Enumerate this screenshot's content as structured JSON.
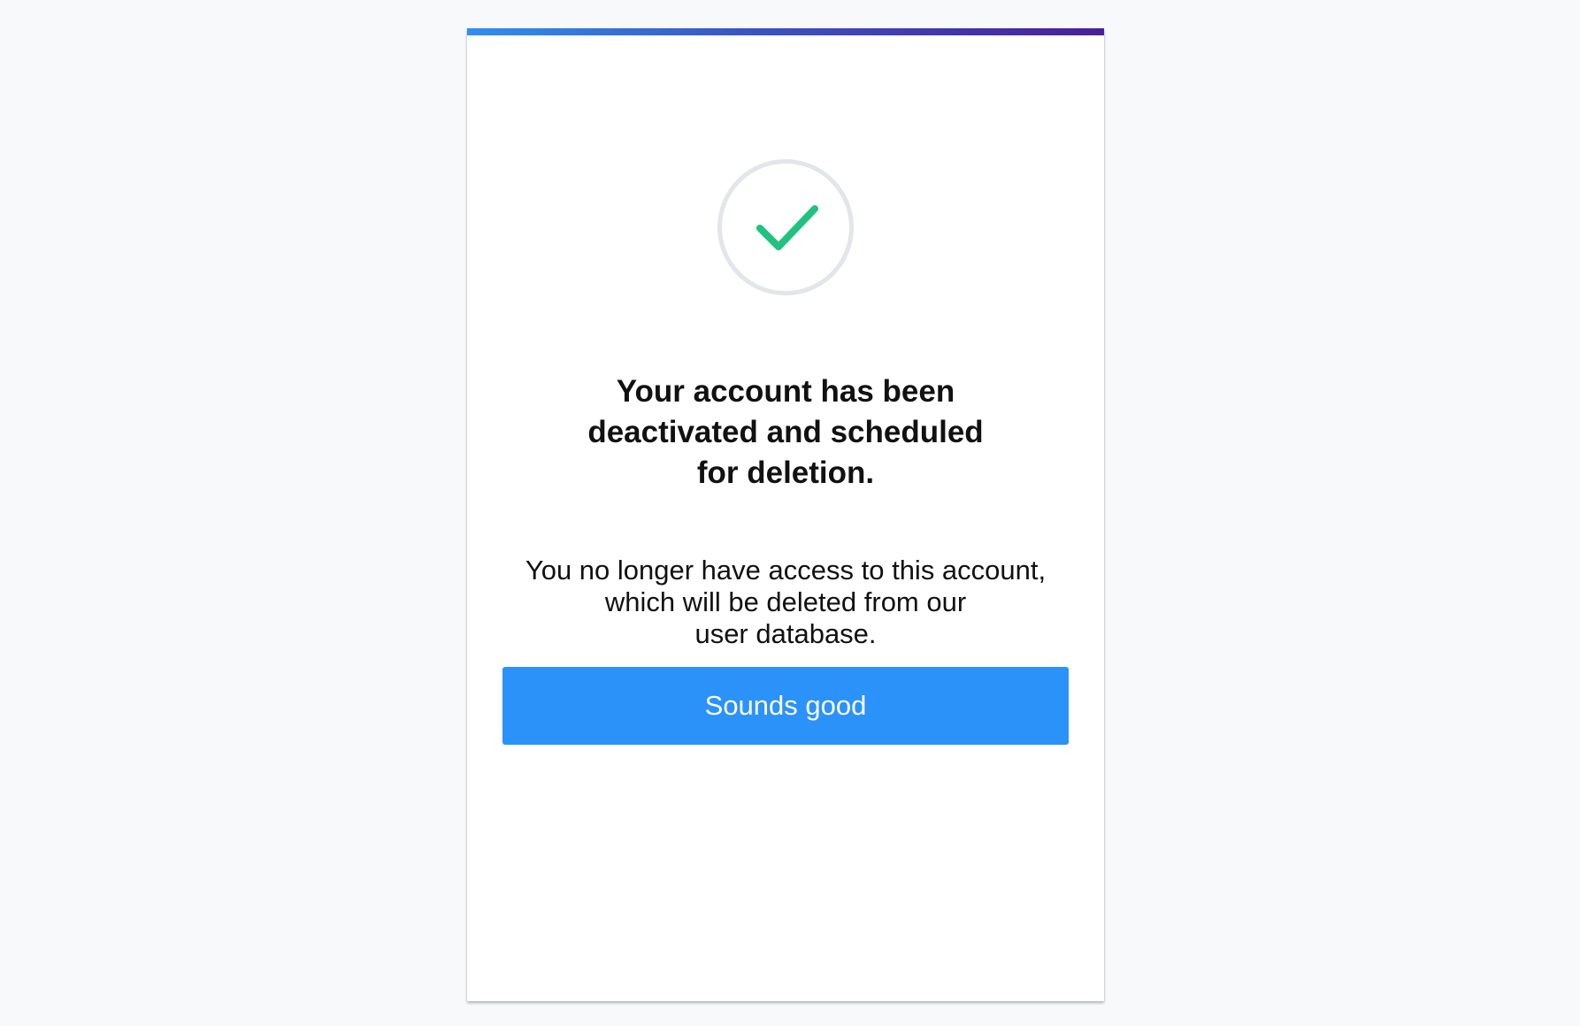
{
  "colors": {
    "page_background": "#f8f9fb",
    "accent_gradient": [
      "#2f8ff0",
      "#3b53c4",
      "#4a1f9a"
    ],
    "check": "#1fc27f",
    "circle_border": "#e2e5ea",
    "button": "#2a92f8"
  },
  "icon": {
    "name": "check-icon"
  },
  "dialog": {
    "title_lines": [
      "Your account has been",
      "deactivated and scheduled",
      "for deletion."
    ],
    "message_lines": [
      "You no longer have access to this account,",
      "which will be deleted from our",
      "user database."
    ],
    "button_label": "Sounds good"
  }
}
